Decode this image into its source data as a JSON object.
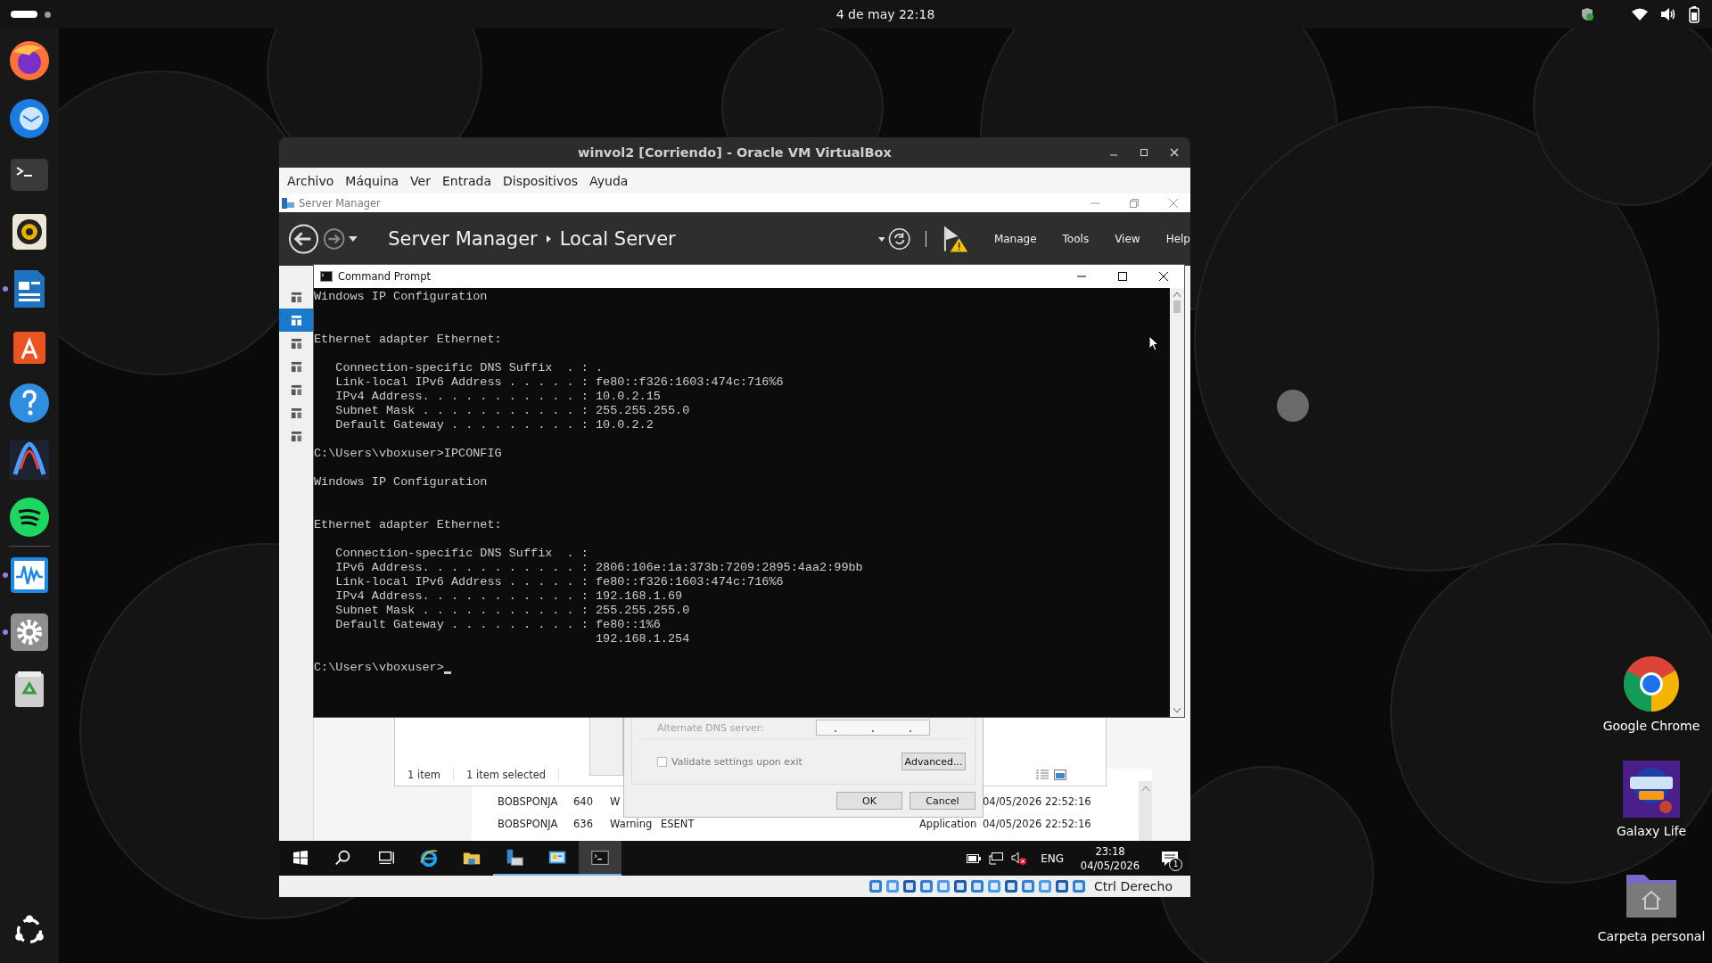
{
  "top_bar": {
    "clock": "4 de may  22:18"
  },
  "dock": [
    {
      "kind": "browser",
      "running": false
    },
    {
      "kind": "mail",
      "running": false
    },
    {
      "kind": "terminal",
      "running": false
    },
    {
      "kind": "speaker",
      "running": false
    },
    {
      "kind": "document",
      "running": true
    },
    {
      "kind": "store",
      "running": false
    },
    {
      "kind": "help",
      "running": false
    },
    {
      "kind": "curve",
      "running": false
    },
    {
      "kind": "music",
      "running": false
    },
    {
      "kind": "monitor",
      "running": true
    },
    {
      "kind": "settings",
      "running": true
    },
    {
      "kind": "trash",
      "running": false
    }
  ],
  "desktop_icons": [
    {
      "kind": "browser",
      "label": "Google Chrome"
    },
    {
      "kind": "game",
      "label": "Galaxy Life"
    },
    {
      "kind": "folder",
      "label": "Carpeta personal"
    }
  ],
  "vm_window": {
    "title": "winvol2 [Corriendo] - Oracle VM VirtualBox",
    "menu": [
      "Archivo",
      "Máquina",
      "Ver",
      "Entrada",
      "Dispositivos",
      "Ayuda"
    ],
    "host_key": "Ctrl Derecho"
  },
  "server_manager": {
    "title": "Server Manager",
    "breadcrumb": [
      "Server Manager",
      "Local Server"
    ],
    "menu": [
      "Manage",
      "Tools",
      "View",
      "Help"
    ],
    "sidebar": [
      {
        "selected": false
      },
      {
        "selected": true
      },
      {
        "selected": false
      },
      {
        "selected": false
      },
      {
        "selected": false
      },
      {
        "selected": false
      },
      {
        "selected": false
      }
    ],
    "status": [
      "1 item",
      "1 item selected"
    ],
    "events": [
      {
        "column_1": "BOBSPONJA",
        "column_2": "640",
        "column_3": "W",
        "column_6": "04/05/2026 22:52:16"
      },
      {
        "column_1": "BOBSPONJA",
        "column_2": "636",
        "column_3": "Warning",
        "column_4": "ESENT",
        "column_5": "Application",
        "column_6": "04/05/2026 22:52:16"
      }
    ]
  },
  "tcp_dialog": {
    "field_label": "Alternate DNS server:",
    "field_disabled": true,
    "validate": {
      "label": "Validate settings upon exit",
      "checked": false
    },
    "advanced": "Advanced...",
    "ok": "OK",
    "cancel": "Cancel"
  },
  "command_prompt": {
    "title": "Command Prompt",
    "output": "Windows IP Configuration\n\n\nEthernet adapter Ethernet:\n\n   Connection-specific DNS Suffix  . : .\n   Link-local IPv6 Address . . . . . : fe80::f326:1603:474c:716%6\n   IPv4 Address. . . . . . . . . . . : 10.0.2.15\n   Subnet Mask . . . . . . . . . . . : 255.255.255.0\n   Default Gateway . . . . . . . . . : 10.0.2.2\n\nC:\\Users\\vboxuser>IPCONFIG\n\nWindows IP Configuration\n\n\nEthernet adapter Ethernet:\n\n   Connection-specific DNS Suffix  . :\n   IPv6 Address. . . . . . . . . . . : 2806:106e:1a:373b:7209:2895:4aa2:99bb\n   Link-local IPv6 Address . . . . . : fe80::f326:1603:474c:716%6\n   IPv4 Address. . . . . . . . . . . : 192.168.1.69\n   Subnet Mask . . . . . . . . . . . : 255.255.255.0\n   Default Gateway . . . . . . . . . : fe80::1%6\n                                       192.168.1.254\n",
    "prompt": "C:\\Users\\vboxuser>"
  },
  "taskbar": {
    "apps": [
      {
        "kind": "search",
        "open": false,
        "selected": false
      },
      {
        "kind": "taskview",
        "open": false,
        "selected": false
      },
      {
        "kind": "ie",
        "open": false,
        "selected": false
      },
      {
        "kind": "explorer",
        "open": false,
        "selected": false
      },
      {
        "kind": "server",
        "open": true,
        "selected": false
      },
      {
        "kind": "control",
        "open": true,
        "selected": false
      },
      {
        "kind": "console",
        "open": true,
        "selected": true
      }
    ],
    "language": "ENG",
    "time": "23:18",
    "date": "04/05/2026",
    "notifications": "1"
  }
}
